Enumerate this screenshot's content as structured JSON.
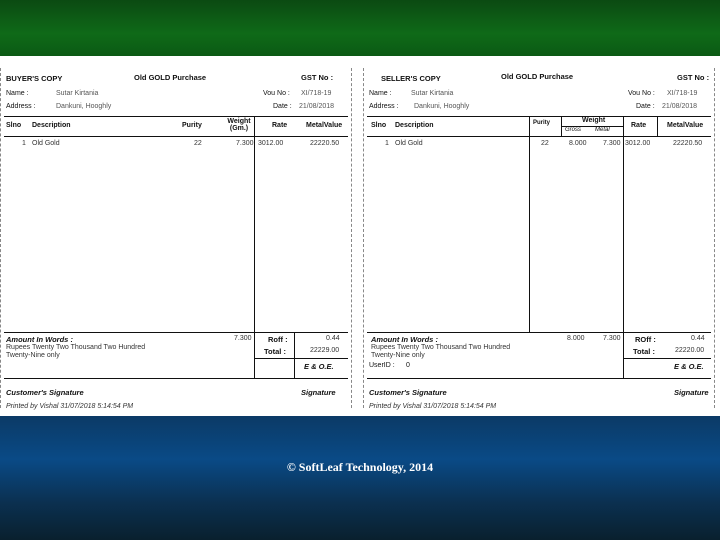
{
  "footer": {
    "copyright": "© SoftLeaf Technology, 2014"
  },
  "buyer": {
    "copy_label": "BUYER'S COPY",
    "form_title": "Old GOLD Purchase",
    "gst_label": "GST No :",
    "name_label": "Name :",
    "name_value": "Sutar Kirtania",
    "vou_label": "Vou No :",
    "vou_value": "XI/718-19",
    "address_label": "Address :",
    "address_value": "Dankuni, Hooghly",
    "date_label": "Date :",
    "date_value": "21/08/2018",
    "columns": [
      "Slno",
      "Description",
      "Purity",
      "Weight (Gm.)",
      "Rate",
      "MetalValue"
    ],
    "row": {
      "slno": "1",
      "description": "Old Gold",
      "purity": "22",
      "weight": "7.300",
      "rate": "3012.00",
      "value": "22220.50"
    },
    "amount_words_label": "Amount In Words :",
    "amount_words": "Rupees Twenty Two Thousand Two Hundred Twenty-Nine only",
    "total_weight": "7.300",
    "roff_label": "Roff :",
    "roff_value": "0.44",
    "total_label": "Total :",
    "total_value": "22229.00",
    "eoe": "E & O.E.",
    "customer_sig": "Customer's Signature",
    "signature": "Signature",
    "printed_by": "Printed by Vishal 31/07/2018 5:14:54 PM"
  },
  "seller": {
    "copy_label": "SELLER'S COPY",
    "form_title": "Old GOLD Purchase",
    "gst_label": "GST No :",
    "name_label": "Name :",
    "name_value": "Sutar Kirtania",
    "vou_label": "Vou No :",
    "vou_value": "XI/718-19",
    "address_label": "Address :",
    "address_value": "Dankuni, Hooghly",
    "date_label": "Date :",
    "date_value": "21/08/2018",
    "columns": [
      "Slno",
      "Description",
      "Purity",
      "Weight",
      "Gross",
      "Metal",
      "Rate",
      "MetalValue"
    ],
    "row": {
      "slno": "1",
      "description": "Old Gold",
      "purity": "22",
      "gross": "8.000",
      "metal": "7.300",
      "rate": "3012.00",
      "value": "22220.50"
    },
    "amount_words_label": "Amount In Words :",
    "amount_words": "Rupees Twenty Two Thousand Two Hundred Twenty-Nine only",
    "total_gross": "8.000",
    "total_metal": "7.300",
    "roff_label": "ROff :",
    "roff_value": "0.44",
    "total_label": "Total :",
    "total_value": "22220.00",
    "user_label": "UserID :",
    "user_value": "0",
    "eoe": "E & O.E.",
    "customer_sig": "Customer's Signature",
    "signature": "Signature",
    "printed_by": "Printed by Vishal 31/07/2018 5:14:54 PM"
  }
}
